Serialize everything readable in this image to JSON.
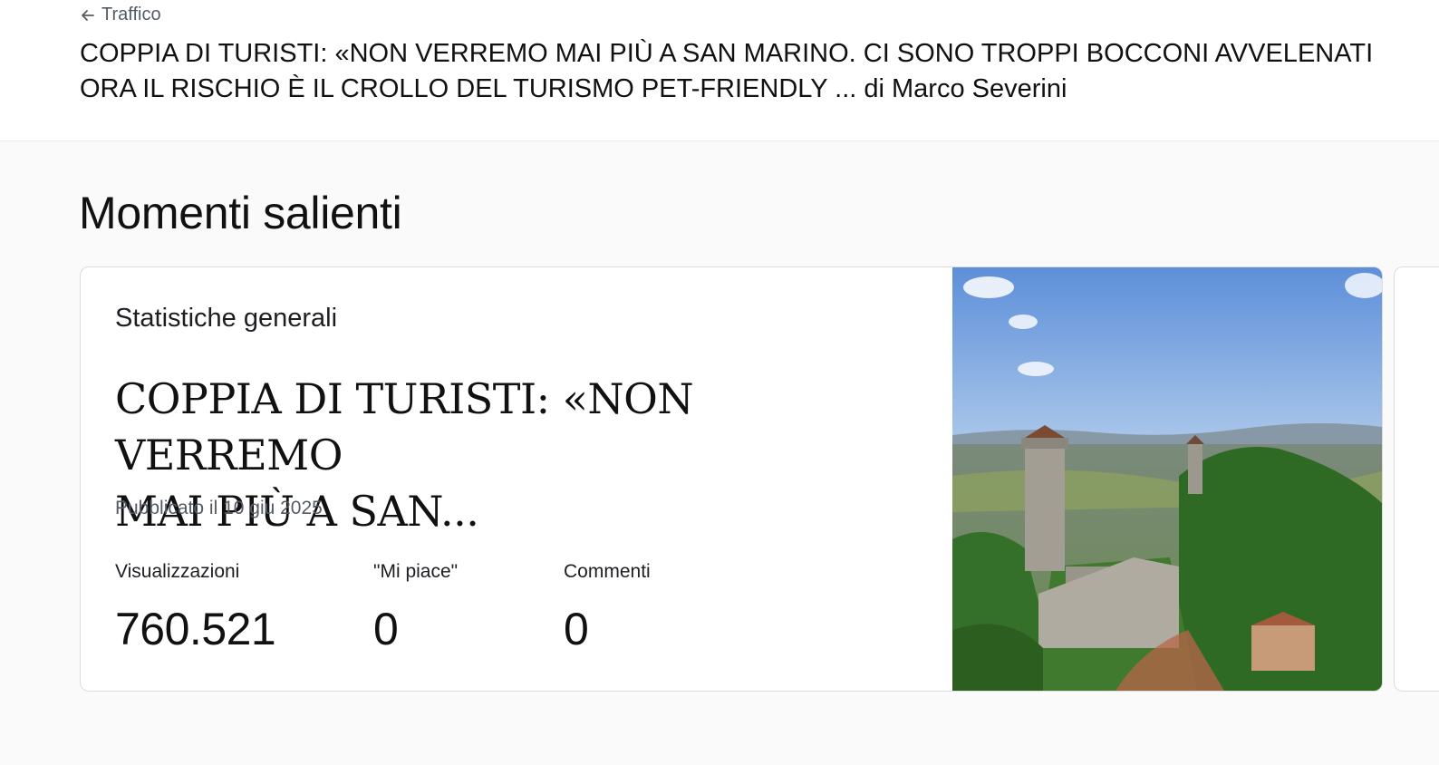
{
  "header": {
    "back_label": "Traffico",
    "title_line1": "COPPIA DI TURISTI: «NON VERREMO MAI PIÙ A SAN MARINO. CI SONO TROPPI BOCCONI AVVELENATI",
    "title_line2": "ORA IL RISCHIO È IL CROLLO DEL TURISMO PET-FRIENDLY ... di Marco Severini"
  },
  "section": {
    "title": "Momenti salienti"
  },
  "card": {
    "label": "Statistiche generali",
    "post_title_line1": "COPPIA DI TURISTI: «NON VERREMO",
    "post_title_line2": "MAI PIÙ A SAN...",
    "published": "Pubblicato il 10 giu 2025",
    "stats": [
      {
        "label": "Visualizzazioni",
        "value": "760.521"
      },
      {
        "label": "\"Mi piace\"",
        "value": "0"
      },
      {
        "label": "Commenti",
        "value": "0"
      }
    ],
    "image_icon": "castle-landscape-photo"
  },
  "colors": {
    "muted_text": "#555b63",
    "card_border": "#dcdcdc",
    "page_bg": "#fafafa"
  }
}
